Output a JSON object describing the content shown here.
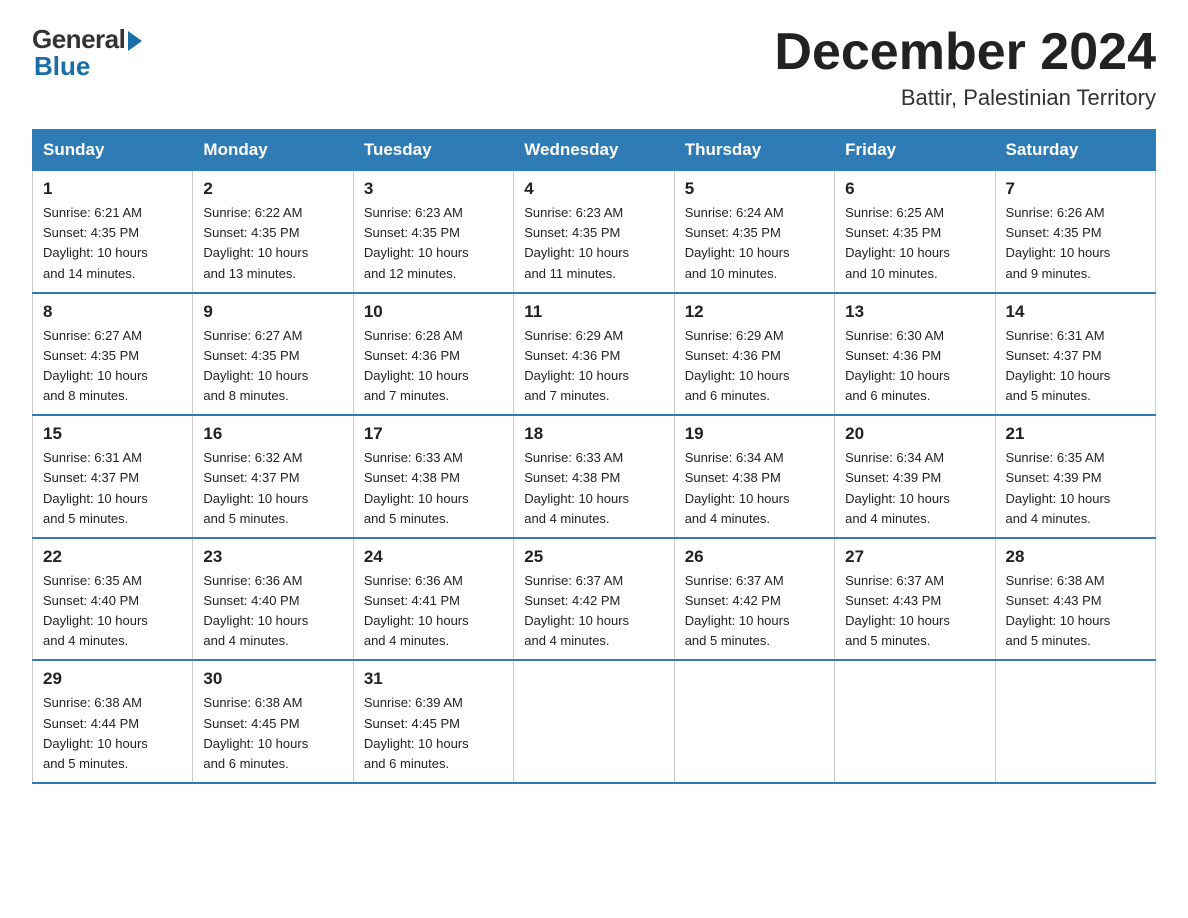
{
  "logo": {
    "general": "General",
    "blue": "Blue"
  },
  "title": {
    "month_year": "December 2024",
    "location": "Battir, Palestinian Territory"
  },
  "days_of_week": [
    "Sunday",
    "Monday",
    "Tuesday",
    "Wednesday",
    "Thursday",
    "Friday",
    "Saturday"
  ],
  "weeks": [
    [
      {
        "day": "1",
        "sunrise": "6:21 AM",
        "sunset": "4:35 PM",
        "daylight": "10 hours and 14 minutes."
      },
      {
        "day": "2",
        "sunrise": "6:22 AM",
        "sunset": "4:35 PM",
        "daylight": "10 hours and 13 minutes."
      },
      {
        "day": "3",
        "sunrise": "6:23 AM",
        "sunset": "4:35 PM",
        "daylight": "10 hours and 12 minutes."
      },
      {
        "day": "4",
        "sunrise": "6:23 AM",
        "sunset": "4:35 PM",
        "daylight": "10 hours and 11 minutes."
      },
      {
        "day": "5",
        "sunrise": "6:24 AM",
        "sunset": "4:35 PM",
        "daylight": "10 hours and 10 minutes."
      },
      {
        "day": "6",
        "sunrise": "6:25 AM",
        "sunset": "4:35 PM",
        "daylight": "10 hours and 10 minutes."
      },
      {
        "day": "7",
        "sunrise": "6:26 AM",
        "sunset": "4:35 PM",
        "daylight": "10 hours and 9 minutes."
      }
    ],
    [
      {
        "day": "8",
        "sunrise": "6:27 AM",
        "sunset": "4:35 PM",
        "daylight": "10 hours and 8 minutes."
      },
      {
        "day": "9",
        "sunrise": "6:27 AM",
        "sunset": "4:35 PM",
        "daylight": "10 hours and 8 minutes."
      },
      {
        "day": "10",
        "sunrise": "6:28 AM",
        "sunset": "4:36 PM",
        "daylight": "10 hours and 7 minutes."
      },
      {
        "day": "11",
        "sunrise": "6:29 AM",
        "sunset": "4:36 PM",
        "daylight": "10 hours and 7 minutes."
      },
      {
        "day": "12",
        "sunrise": "6:29 AM",
        "sunset": "4:36 PM",
        "daylight": "10 hours and 6 minutes."
      },
      {
        "day": "13",
        "sunrise": "6:30 AM",
        "sunset": "4:36 PM",
        "daylight": "10 hours and 6 minutes."
      },
      {
        "day": "14",
        "sunrise": "6:31 AM",
        "sunset": "4:37 PM",
        "daylight": "10 hours and 5 minutes."
      }
    ],
    [
      {
        "day": "15",
        "sunrise": "6:31 AM",
        "sunset": "4:37 PM",
        "daylight": "10 hours and 5 minutes."
      },
      {
        "day": "16",
        "sunrise": "6:32 AM",
        "sunset": "4:37 PM",
        "daylight": "10 hours and 5 minutes."
      },
      {
        "day": "17",
        "sunrise": "6:33 AM",
        "sunset": "4:38 PM",
        "daylight": "10 hours and 5 minutes."
      },
      {
        "day": "18",
        "sunrise": "6:33 AM",
        "sunset": "4:38 PM",
        "daylight": "10 hours and 4 minutes."
      },
      {
        "day": "19",
        "sunrise": "6:34 AM",
        "sunset": "4:38 PM",
        "daylight": "10 hours and 4 minutes."
      },
      {
        "day": "20",
        "sunrise": "6:34 AM",
        "sunset": "4:39 PM",
        "daylight": "10 hours and 4 minutes."
      },
      {
        "day": "21",
        "sunrise": "6:35 AM",
        "sunset": "4:39 PM",
        "daylight": "10 hours and 4 minutes."
      }
    ],
    [
      {
        "day": "22",
        "sunrise": "6:35 AM",
        "sunset": "4:40 PM",
        "daylight": "10 hours and 4 minutes."
      },
      {
        "day": "23",
        "sunrise": "6:36 AM",
        "sunset": "4:40 PM",
        "daylight": "10 hours and 4 minutes."
      },
      {
        "day": "24",
        "sunrise": "6:36 AM",
        "sunset": "4:41 PM",
        "daylight": "10 hours and 4 minutes."
      },
      {
        "day": "25",
        "sunrise": "6:37 AM",
        "sunset": "4:42 PM",
        "daylight": "10 hours and 4 minutes."
      },
      {
        "day": "26",
        "sunrise": "6:37 AM",
        "sunset": "4:42 PM",
        "daylight": "10 hours and 5 minutes."
      },
      {
        "day": "27",
        "sunrise": "6:37 AM",
        "sunset": "4:43 PM",
        "daylight": "10 hours and 5 minutes."
      },
      {
        "day": "28",
        "sunrise": "6:38 AM",
        "sunset": "4:43 PM",
        "daylight": "10 hours and 5 minutes."
      }
    ],
    [
      {
        "day": "29",
        "sunrise": "6:38 AM",
        "sunset": "4:44 PM",
        "daylight": "10 hours and 5 minutes."
      },
      {
        "day": "30",
        "sunrise": "6:38 AM",
        "sunset": "4:45 PM",
        "daylight": "10 hours and 6 minutes."
      },
      {
        "day": "31",
        "sunrise": "6:39 AM",
        "sunset": "4:45 PM",
        "daylight": "10 hours and 6 minutes."
      },
      null,
      null,
      null,
      null
    ]
  ],
  "labels": {
    "sunrise": "Sunrise:",
    "sunset": "Sunset:",
    "daylight": "Daylight:"
  }
}
